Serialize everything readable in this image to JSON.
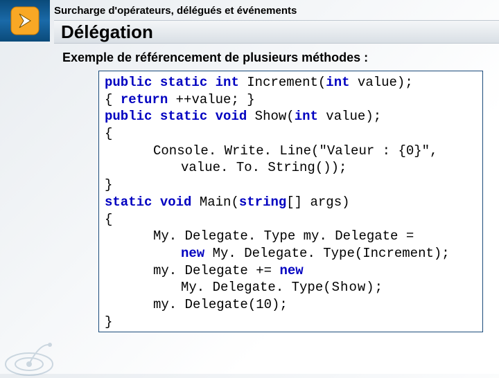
{
  "header": {
    "subtitle": "Surcharge d'opérateurs, délégués et événements",
    "title": "Délégation"
  },
  "content": {
    "example_label": "Exemple de référencement de plusieurs méthodes :"
  },
  "code": {
    "kw_public": "public",
    "kw_static": "static",
    "kw_int": "int",
    "kw_void": "void",
    "kw_return": "return",
    "kw_new": "new",
    "kw_string": "string",
    "l1a": " Increment(",
    "l1b": " value);",
    "l2a": "{ ",
    "l2b": " ++value; }",
    "l3a": " Show(",
    "l3b": " value);",
    "l4": "{",
    "l5": "Console. Write. Line(\"Valeur : {0}\",",
    "l6": "value. To. String());",
    "l7": "}",
    "l8a": " Main(",
    "l8b": "[] args)",
    "l9": "{",
    "l10": "My. Delegate. Type my. Delegate =",
    "l11a": " My. Delegate. Type(Increment);",
    "l12a": "my. Delegate += ",
    "l13a": "My. Delegate. Type",
    "l13b": "(Show)",
    "l13c": ";",
    "l14": "my. Delegate(10);",
    "l15": "}"
  }
}
